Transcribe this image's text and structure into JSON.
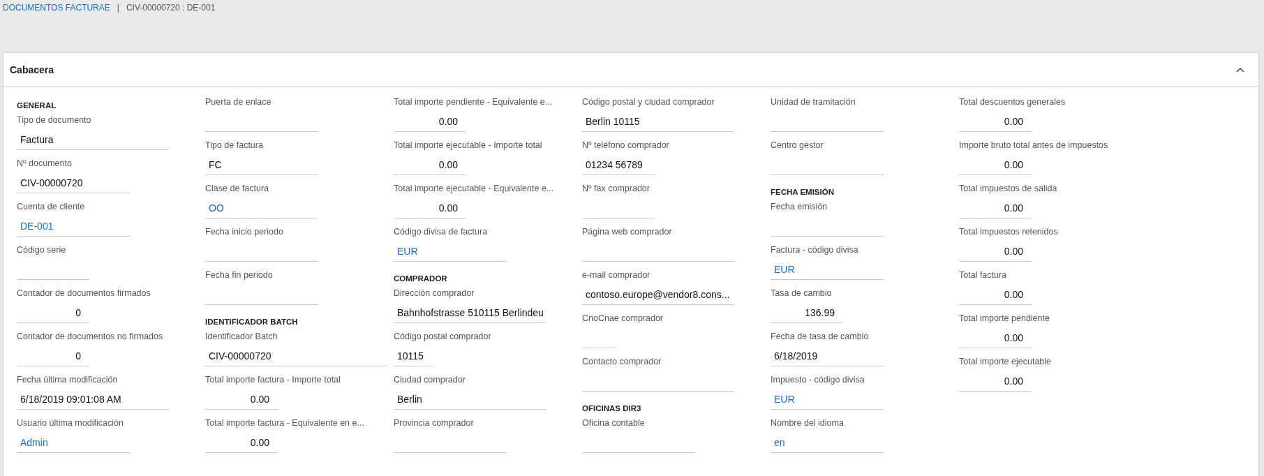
{
  "breadcrumb": {
    "link": "DOCUMENTOS FACTURAE",
    "separator": "|",
    "current": "CIV-00000720 : DE-001"
  },
  "panel": {
    "title": "Cabacera",
    "expanded": true,
    "columns": [
      [
        {
          "kind": "section",
          "label": "GENERAL"
        },
        {
          "kind": "text",
          "label": "Tipo de documento",
          "value": "Factura"
        },
        {
          "kind": "text",
          "label": "Nº documento",
          "value": "CIV-00000720"
        },
        {
          "kind": "link",
          "label": "Cuenta de cliente",
          "value": "DE-001"
        },
        {
          "kind": "text",
          "label": "Código serie"
        },
        {
          "kind": "number",
          "label": "Contador de documentos firmados",
          "value": "0"
        },
        {
          "kind": "number",
          "label": "Contador de documentos no firmados",
          "value": "0"
        },
        {
          "kind": "text",
          "label": "Fecha última modificación",
          "value": "6/18/2019 09:01:08 AM"
        },
        {
          "kind": "link",
          "label": "Usuario última modificación",
          "value": "Admin"
        }
      ],
      [
        {
          "kind": "text",
          "label": "Puerta de enlace"
        },
        {
          "kind": "text",
          "label": "Tipo de factura",
          "value": "FC"
        },
        {
          "kind": "link",
          "label": "Clase de factura",
          "value": "OO"
        },
        {
          "kind": "text",
          "label": "Fecha inicio periodo"
        },
        {
          "kind": "text",
          "label": "Fecha fin periodo"
        },
        {
          "kind": "section",
          "label": "IDENTIFICADOR BATCH"
        },
        {
          "kind": "text",
          "label": "Identificador Batch",
          "value": "CIV-00000720"
        },
        {
          "kind": "number",
          "label": "Total importe factura - Importe total",
          "value": "0.00"
        },
        {
          "kind": "number",
          "label": "Total importe factura - Equivalente en e...",
          "value": "0.00"
        }
      ],
      [
        {
          "kind": "number",
          "label": "Total importe pendiente - Equivalente e...",
          "value": "0.00"
        },
        {
          "kind": "number",
          "label": "Total importe ejecutable - Importe total",
          "value": "0.00"
        },
        {
          "kind": "number",
          "label": "Total importe ejecutable - Equivalente e...",
          "value": "0.00"
        },
        {
          "kind": "link",
          "label": "Código divisa de factura",
          "value": "EUR"
        },
        {
          "kind": "section",
          "label": "COMPRADOR"
        },
        {
          "kind": "text",
          "label": "Dirección comprador",
          "value": "Bahnhofstrasse 510115 Berlindeu"
        },
        {
          "kind": "text",
          "label": "Código postal comprador",
          "value": "10115"
        },
        {
          "kind": "text",
          "label": "Ciudad comprador",
          "value": "Berlin"
        },
        {
          "kind": "text",
          "label": "Provincia comprador"
        }
      ],
      [
        {
          "kind": "text",
          "label": "Código postal y ciudad comprador",
          "value": "Berlin 10115"
        },
        {
          "kind": "text",
          "label": "Nº teléfono comprador",
          "value": "01234 56789"
        },
        {
          "kind": "text",
          "label": "Nº fax comprador"
        },
        {
          "kind": "text",
          "label": "Página web comprador"
        },
        {
          "kind": "text",
          "label": "e-mail comprador",
          "value": "contoso.europe@vendor8.cons..."
        },
        {
          "kind": "text",
          "label": "CnoCnae comprador"
        },
        {
          "kind": "text",
          "label": "Contacto comprador"
        },
        {
          "kind": "section",
          "label": "OFICINAS DIR3"
        },
        {
          "kind": "text",
          "label": "Oficina contable"
        }
      ],
      [
        {
          "kind": "text",
          "label": "Unidad de tramitación"
        },
        {
          "kind": "text",
          "label": "Centro gestor"
        },
        {
          "kind": "section",
          "label": "FECHA EMISIÓN"
        },
        {
          "kind": "text",
          "label": "Fecha emisión"
        },
        {
          "kind": "link",
          "label": "Factura - código divisa",
          "value": "EUR"
        },
        {
          "kind": "number",
          "label": "Tasa de cambio",
          "value": "136.99"
        },
        {
          "kind": "text",
          "label": "Fecha de tasa de cambio",
          "value": "6/18/2019"
        },
        {
          "kind": "link",
          "label": "Impuesto - código divisa",
          "value": "EUR"
        },
        {
          "kind": "link",
          "label": "Nombre del idioma",
          "value": "en"
        }
      ],
      [
        {
          "kind": "number",
          "label": "Total descuentos generales",
          "value": "0.00"
        },
        {
          "kind": "number",
          "label": "Importe bruto total antes de impuestos",
          "value": "0.00"
        },
        {
          "kind": "number",
          "label": "Total impuestos de salida",
          "value": "0.00"
        },
        {
          "kind": "number",
          "label": "Total impuestos retenidos",
          "value": "0.00"
        },
        {
          "kind": "number",
          "label": "Total factura",
          "value": "0.00"
        },
        {
          "kind": "number",
          "label": "Total importe pendiente",
          "value": "0.00"
        },
        {
          "kind": "number",
          "label": "Total importe ejecutable",
          "value": "0.00"
        }
      ]
    ]
  }
}
